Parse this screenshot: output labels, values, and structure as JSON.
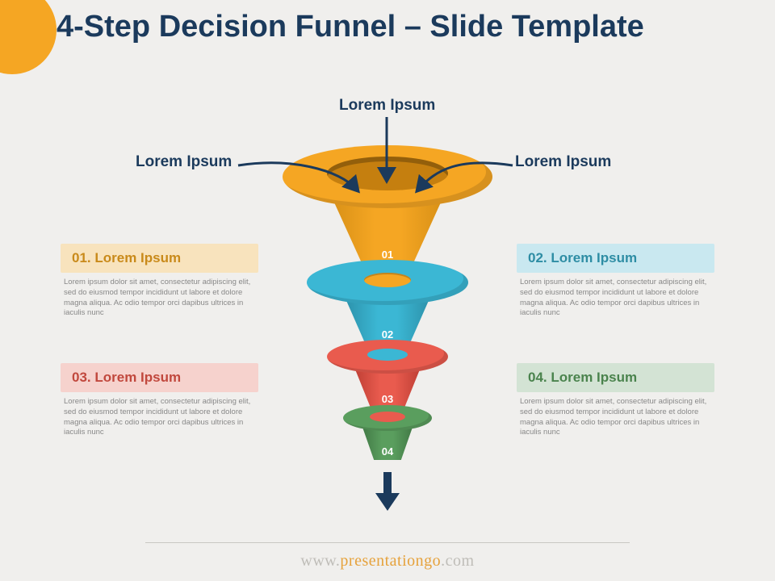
{
  "title": "4-Step Decision Funnel – Slide Template",
  "inputs": {
    "top": "Lorem Ipsum",
    "left": "Lorem Ipsum",
    "right": "Lorem Ipsum"
  },
  "segments": [
    {
      "num": "01",
      "color": "#f5a623"
    },
    {
      "num": "02",
      "color": "#3bb7d4"
    },
    {
      "num": "03",
      "color": "#e95b4e"
    },
    {
      "num": "04",
      "color": "#5a9e5e"
    }
  ],
  "callouts": [
    {
      "heading": "01. Lorem Ipsum",
      "body": "Lorem ipsum dolor sit amet, consectetur adipiscing elit, sed do eiusmod tempor incididunt ut labore et dolore magna aliqua. Ac odio tempor orci dapibus ultrices in iaculis nunc"
    },
    {
      "heading": "02. Lorem Ipsum",
      "body": "Lorem ipsum dolor sit amet, consectetur adipiscing elit, sed do eiusmod tempor incididunt ut labore et dolore magna aliqua. Ac odio tempor orci dapibus ultrices in iaculis nunc"
    },
    {
      "heading": "03. Lorem Ipsum",
      "body": "Lorem ipsum dolor sit amet, consectetur adipiscing elit, sed do eiusmod tempor incididunt ut labore et dolore magna aliqua. Ac odio tempor orci dapibus ultrices in iaculis nunc"
    },
    {
      "heading": "04. Lorem Ipsum",
      "body": "Lorem ipsum dolor sit amet, consectetur adipiscing elit, sed do eiusmod tempor incididunt ut labore et dolore magna aliqua. Ac odio tempor orci dapibus ultrices in iaculis nunc"
    }
  ],
  "footer": {
    "prefix": "www.",
    "mid": "presentationgo",
    "suffix": ".com"
  }
}
